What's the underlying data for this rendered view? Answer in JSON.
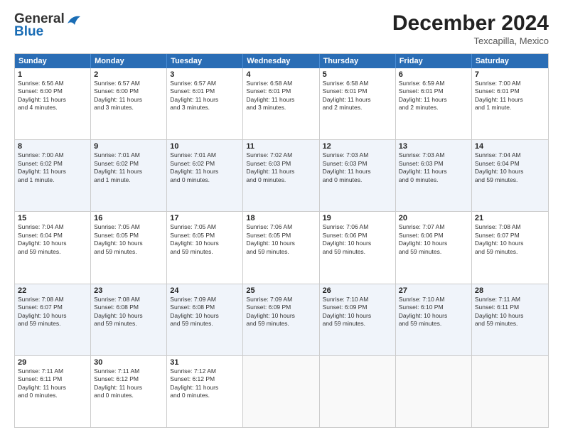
{
  "header": {
    "logo_line1": "General",
    "logo_line2": "Blue",
    "month_title": "December 2024",
    "location": "Texcapilla, Mexico"
  },
  "days_of_week": [
    "Sunday",
    "Monday",
    "Tuesday",
    "Wednesday",
    "Thursday",
    "Friday",
    "Saturday"
  ],
  "rows": [
    [
      {
        "day": "1",
        "lines": [
          "Sunrise: 6:56 AM",
          "Sunset: 6:00 PM",
          "Daylight: 11 hours",
          "and 4 minutes."
        ]
      },
      {
        "day": "2",
        "lines": [
          "Sunrise: 6:57 AM",
          "Sunset: 6:00 PM",
          "Daylight: 11 hours",
          "and 3 minutes."
        ]
      },
      {
        "day": "3",
        "lines": [
          "Sunrise: 6:57 AM",
          "Sunset: 6:01 PM",
          "Daylight: 11 hours",
          "and 3 minutes."
        ]
      },
      {
        "day": "4",
        "lines": [
          "Sunrise: 6:58 AM",
          "Sunset: 6:01 PM",
          "Daylight: 11 hours",
          "and 3 minutes."
        ]
      },
      {
        "day": "5",
        "lines": [
          "Sunrise: 6:58 AM",
          "Sunset: 6:01 PM",
          "Daylight: 11 hours",
          "and 2 minutes."
        ]
      },
      {
        "day": "6",
        "lines": [
          "Sunrise: 6:59 AM",
          "Sunset: 6:01 PM",
          "Daylight: 11 hours",
          "and 2 minutes."
        ]
      },
      {
        "day": "7",
        "lines": [
          "Sunrise: 7:00 AM",
          "Sunset: 6:01 PM",
          "Daylight: 11 hours",
          "and 1 minute."
        ]
      }
    ],
    [
      {
        "day": "8",
        "lines": [
          "Sunrise: 7:00 AM",
          "Sunset: 6:02 PM",
          "Daylight: 11 hours",
          "and 1 minute."
        ]
      },
      {
        "day": "9",
        "lines": [
          "Sunrise: 7:01 AM",
          "Sunset: 6:02 PM",
          "Daylight: 11 hours",
          "and 1 minute."
        ]
      },
      {
        "day": "10",
        "lines": [
          "Sunrise: 7:01 AM",
          "Sunset: 6:02 PM",
          "Daylight: 11 hours",
          "and 0 minutes."
        ]
      },
      {
        "day": "11",
        "lines": [
          "Sunrise: 7:02 AM",
          "Sunset: 6:03 PM",
          "Daylight: 11 hours",
          "and 0 minutes."
        ]
      },
      {
        "day": "12",
        "lines": [
          "Sunrise: 7:03 AM",
          "Sunset: 6:03 PM",
          "Daylight: 11 hours",
          "and 0 minutes."
        ]
      },
      {
        "day": "13",
        "lines": [
          "Sunrise: 7:03 AM",
          "Sunset: 6:03 PM",
          "Daylight: 11 hours",
          "and 0 minutes."
        ]
      },
      {
        "day": "14",
        "lines": [
          "Sunrise: 7:04 AM",
          "Sunset: 6:04 PM",
          "Daylight: 10 hours",
          "and 59 minutes."
        ]
      }
    ],
    [
      {
        "day": "15",
        "lines": [
          "Sunrise: 7:04 AM",
          "Sunset: 6:04 PM",
          "Daylight: 10 hours",
          "and 59 minutes."
        ]
      },
      {
        "day": "16",
        "lines": [
          "Sunrise: 7:05 AM",
          "Sunset: 6:05 PM",
          "Daylight: 10 hours",
          "and 59 minutes."
        ]
      },
      {
        "day": "17",
        "lines": [
          "Sunrise: 7:05 AM",
          "Sunset: 6:05 PM",
          "Daylight: 10 hours",
          "and 59 minutes."
        ]
      },
      {
        "day": "18",
        "lines": [
          "Sunrise: 7:06 AM",
          "Sunset: 6:05 PM",
          "Daylight: 10 hours",
          "and 59 minutes."
        ]
      },
      {
        "day": "19",
        "lines": [
          "Sunrise: 7:06 AM",
          "Sunset: 6:06 PM",
          "Daylight: 10 hours",
          "and 59 minutes."
        ]
      },
      {
        "day": "20",
        "lines": [
          "Sunrise: 7:07 AM",
          "Sunset: 6:06 PM",
          "Daylight: 10 hours",
          "and 59 minutes."
        ]
      },
      {
        "day": "21",
        "lines": [
          "Sunrise: 7:08 AM",
          "Sunset: 6:07 PM",
          "Daylight: 10 hours",
          "and 59 minutes."
        ]
      }
    ],
    [
      {
        "day": "22",
        "lines": [
          "Sunrise: 7:08 AM",
          "Sunset: 6:07 PM",
          "Daylight: 10 hours",
          "and 59 minutes."
        ]
      },
      {
        "day": "23",
        "lines": [
          "Sunrise: 7:08 AM",
          "Sunset: 6:08 PM",
          "Daylight: 10 hours",
          "and 59 minutes."
        ]
      },
      {
        "day": "24",
        "lines": [
          "Sunrise: 7:09 AM",
          "Sunset: 6:08 PM",
          "Daylight: 10 hours",
          "and 59 minutes."
        ]
      },
      {
        "day": "25",
        "lines": [
          "Sunrise: 7:09 AM",
          "Sunset: 6:09 PM",
          "Daylight: 10 hours",
          "and 59 minutes."
        ]
      },
      {
        "day": "26",
        "lines": [
          "Sunrise: 7:10 AM",
          "Sunset: 6:09 PM",
          "Daylight: 10 hours",
          "and 59 minutes."
        ]
      },
      {
        "day": "27",
        "lines": [
          "Sunrise: 7:10 AM",
          "Sunset: 6:10 PM",
          "Daylight: 10 hours",
          "and 59 minutes."
        ]
      },
      {
        "day": "28",
        "lines": [
          "Sunrise: 7:11 AM",
          "Sunset: 6:11 PM",
          "Daylight: 10 hours",
          "and 59 minutes."
        ]
      }
    ],
    [
      {
        "day": "29",
        "lines": [
          "Sunrise: 7:11 AM",
          "Sunset: 6:11 PM",
          "Daylight: 11 hours",
          "and 0 minutes."
        ]
      },
      {
        "day": "30",
        "lines": [
          "Sunrise: 7:11 AM",
          "Sunset: 6:12 PM",
          "Daylight: 11 hours",
          "and 0 minutes."
        ]
      },
      {
        "day": "31",
        "lines": [
          "Sunrise: 7:12 AM",
          "Sunset: 6:12 PM",
          "Daylight: 11 hours",
          "and 0 minutes."
        ]
      },
      {
        "day": "",
        "lines": []
      },
      {
        "day": "",
        "lines": []
      },
      {
        "day": "",
        "lines": []
      },
      {
        "day": "",
        "lines": []
      }
    ]
  ]
}
